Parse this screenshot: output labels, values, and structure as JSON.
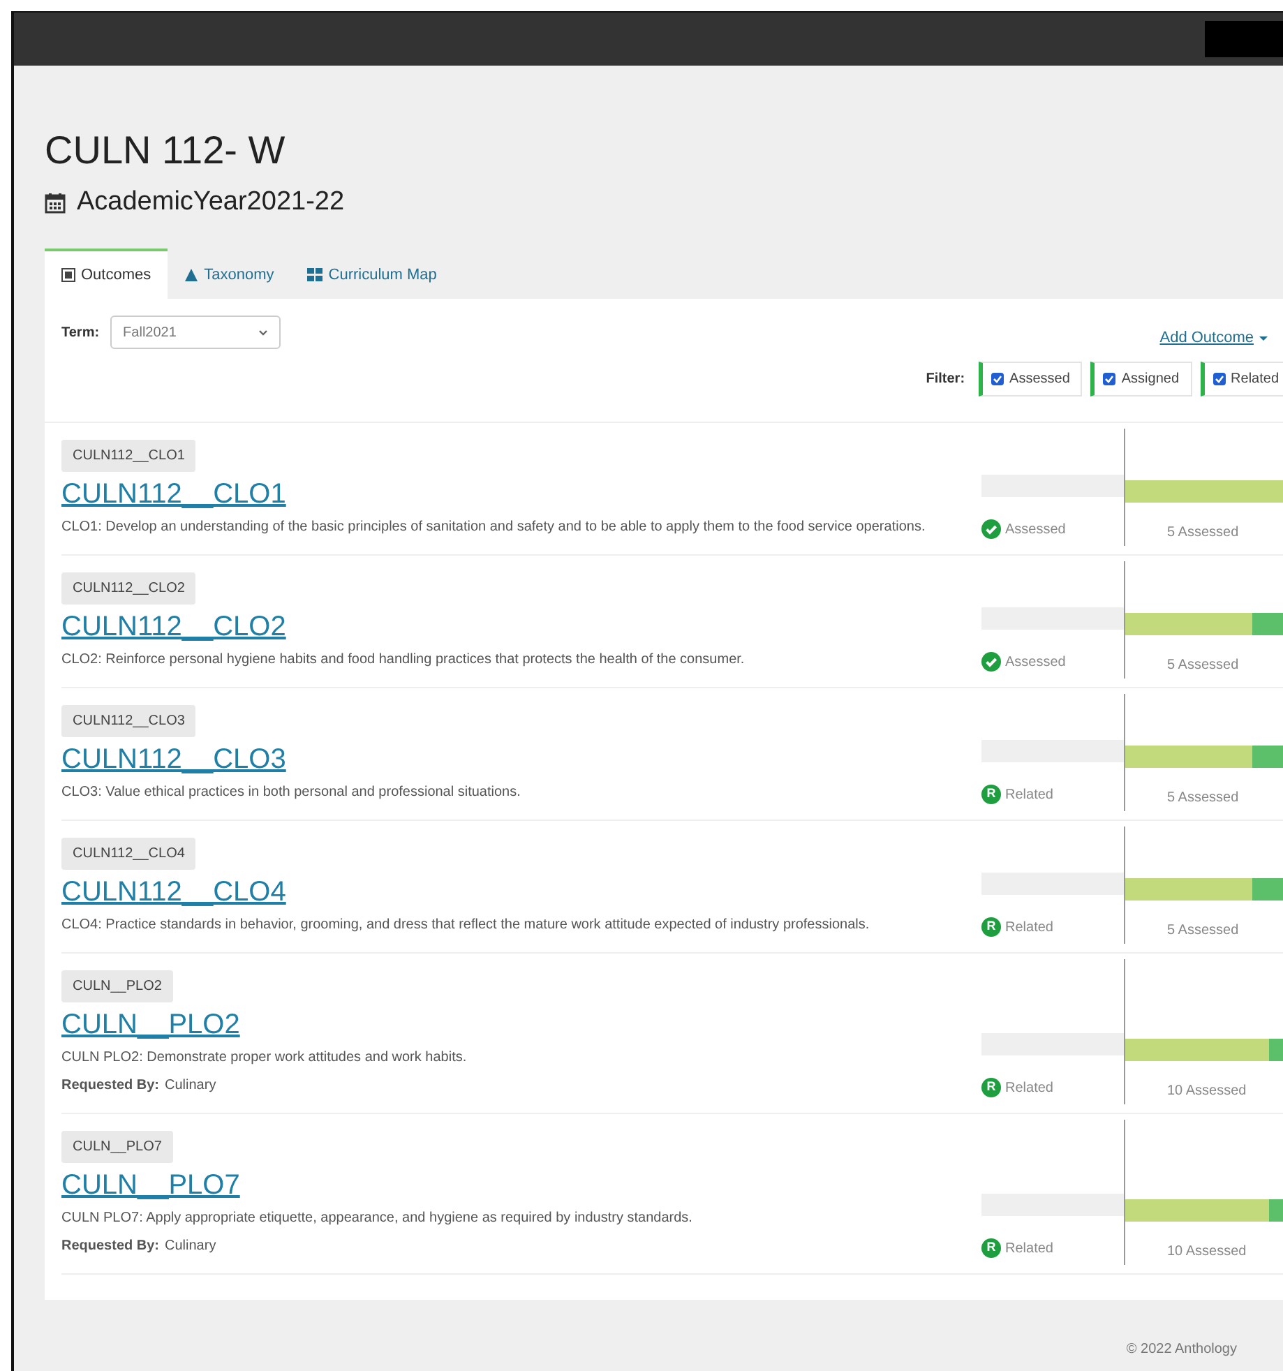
{
  "title": "CULN 112- W",
  "subtitle": "AcademicYear2021-22",
  "tabs": [
    {
      "label": "Outcomes",
      "selected": true,
      "kind": "list"
    },
    {
      "label": "Taxonomy",
      "selected": false,
      "kind": "triangle"
    },
    {
      "label": "Curriculum Map",
      "selected": false,
      "kind": "grid"
    }
  ],
  "term": {
    "label": "Term:",
    "value": "Fall2021"
  },
  "add_outcome": "Add Outcome",
  "filter": {
    "label": "Filter:",
    "options": [
      {
        "label": "Assessed",
        "checked": true
      },
      {
        "label": "Assigned",
        "checked": true
      },
      {
        "label": "Related",
        "checked": true
      }
    ]
  },
  "outcomes": [
    {
      "tag": "CULN112__CLO1",
      "title": "CULN112__CLO1",
      "description": "CLO1: Develop an understanding of the basic principles of sanitation and safety and to be able to apply them to the food service operations.",
      "status": {
        "kind": "assessed",
        "label": "Assessed"
      },
      "level": 1.0,
      "count": "5 Assessed"
    },
    {
      "tag": "CULN112__CLO2",
      "title": "CULN112__CLO2",
      "description": "CLO2: Reinforce personal hygiene habits and food handling practices that protects the health of the consumer.",
      "status": {
        "kind": "assessed",
        "label": "Assessed"
      },
      "level": 0.8,
      "count": "5 Assessed"
    },
    {
      "tag": "CULN112__CLO3",
      "title": "CULN112__CLO3",
      "description": "CLO3: Value ethical practices in both personal and professional situations.",
      "status": {
        "kind": "related",
        "badge": "R",
        "label": "Related"
      },
      "level": 0.8,
      "count": "5 Assessed"
    },
    {
      "tag": "CULN112__CLO4",
      "title": "CULN112__CLO4",
      "description": "CLO4: Practice standards in behavior, grooming, and dress that reflect the mature work attitude expected of industry professionals.",
      "status": {
        "kind": "related",
        "badge": "R",
        "label": "Related"
      },
      "level": 0.8,
      "count": "5 Assessed"
    },
    {
      "tag": "CULN__PLO2",
      "title": "CULN__PLO2",
      "description": "CULN PLO2: Demonstrate proper work attitudes and work habits.",
      "requested_by": {
        "label": "Requested By:",
        "value": "Culinary"
      },
      "status": {
        "kind": "related",
        "badge": "R",
        "label": "Related"
      },
      "level": 0.9,
      "count": "10 Assessed"
    },
    {
      "tag": "CULN__PLO7",
      "title": "CULN__PLO7",
      "description": "CULN PLO7: Apply appropriate etiquette, appearance, and hygiene as required by industry standards.",
      "requested_by": {
        "label": "Requested By:",
        "value": "Culinary"
      },
      "status": {
        "kind": "related",
        "badge": "R",
        "label": "Related"
      },
      "level": 0.9,
      "count": "10 Assessed"
    }
  ],
  "footer": "© 2022 Anthology"
}
